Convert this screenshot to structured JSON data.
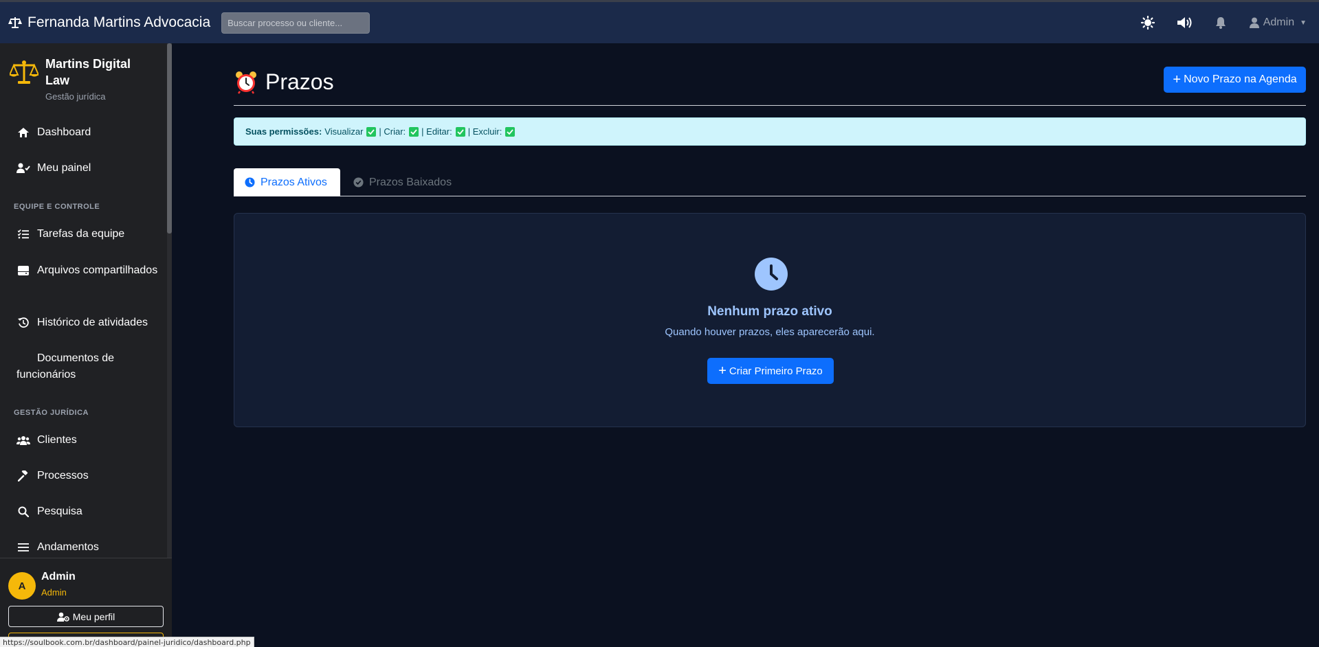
{
  "topbar": {
    "brand": "Fernanda Martins Advocacia",
    "search_placeholder": "Buscar processo ou cliente...",
    "user_label": "Admin"
  },
  "sidebar": {
    "brand_title": "Martins Digital Law",
    "brand_subtitle": "Gestão jurídica",
    "items": [
      {
        "label": "Dashboard",
        "icon": "home-icon"
      },
      {
        "label": "Meu painel",
        "icon": "user-check-icon"
      },
      {
        "label": "Tarefas da equipe",
        "icon": "list-check-icon"
      },
      {
        "label": "Arquivos compartilhados",
        "icon": "hdd-icon"
      },
      {
        "label": "Histórico de atividades",
        "icon": "history-icon"
      },
      {
        "label": "Documentos de funcionários",
        "icon": "none"
      },
      {
        "label": "Clientes",
        "icon": "users-icon"
      },
      {
        "label": "Processos",
        "icon": "gavel-icon"
      },
      {
        "label": "Pesquisa",
        "icon": "search-icon"
      },
      {
        "label": "Andamentos",
        "icon": "bars-icon"
      }
    ],
    "sections": {
      "team": "EQUIPE E CONTROLE",
      "legal": "GESTÃO JURÍDICA"
    },
    "user": {
      "initial": "A",
      "name": "Admin",
      "role": "Admin",
      "profile_button": "Meu perfil"
    }
  },
  "main": {
    "title": "Prazos",
    "new_button": "Novo Prazo na Agenda",
    "permissions": {
      "label": "Suas permissões:",
      "view": "Visualizar",
      "create": "| Criar:",
      "edit": "| Editar:",
      "delete": "| Excluir:"
    },
    "tabs": [
      {
        "label": "Prazos Ativos",
        "active": true
      },
      {
        "label": "Prazos Baixados",
        "active": false
      }
    ],
    "empty": {
      "title": "Nenhum prazo ativo",
      "description": "Quando houver prazos, eles aparecerão aqui.",
      "button": "Criar Primeiro Prazo"
    }
  },
  "status_url": "https://soulbook.com.br/dashboard/painel-juridico/dashboard.php",
  "colors": {
    "topbar": "#1b2a4a",
    "sidebar": "#202124",
    "background": "#0b1120",
    "primary": "#0d6efd",
    "accent": "#f5b80a",
    "info_bg": "#cff4fc"
  }
}
